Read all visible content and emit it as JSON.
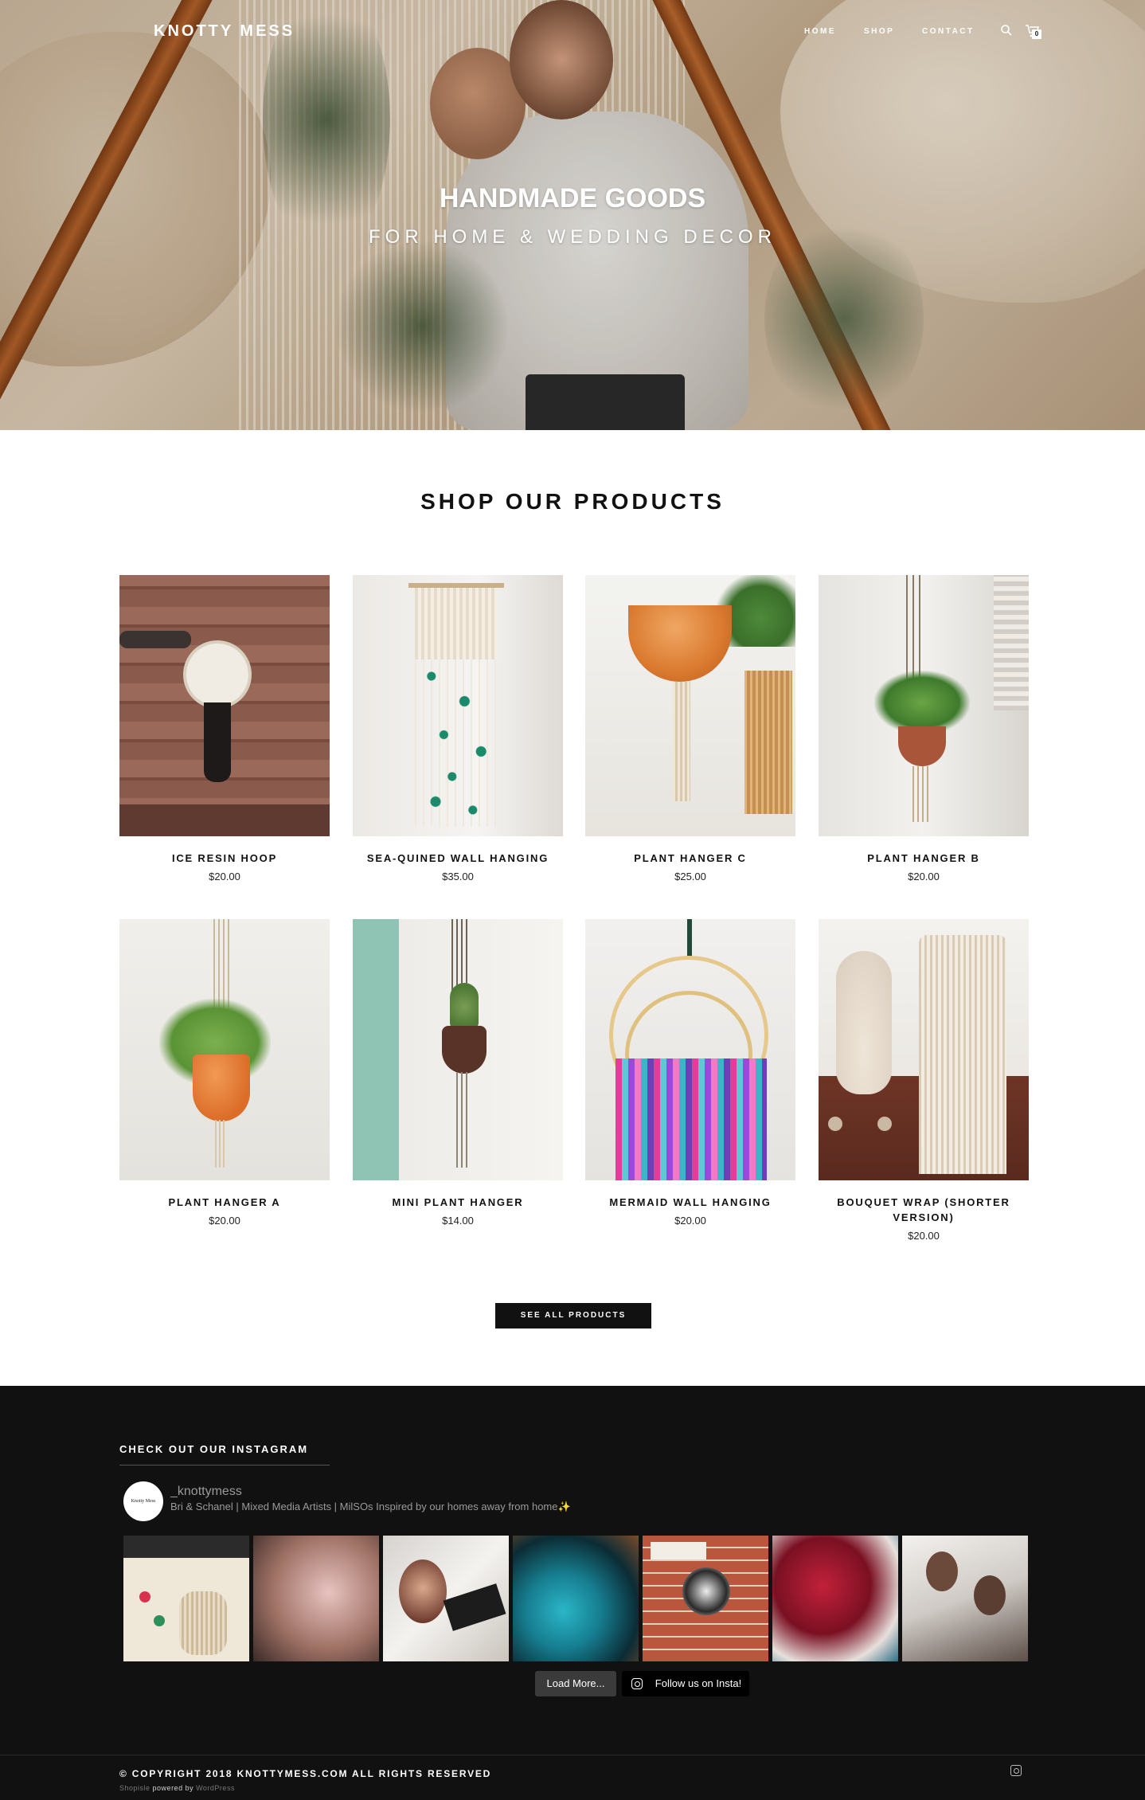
{
  "header": {
    "logo": "KNOTTY MESS",
    "nav": {
      "home": "HOME",
      "shop": "SHOP",
      "contact": "CONTACT"
    },
    "cart_count": "0",
    "icons": [
      "search-icon",
      "cart-icon"
    ]
  },
  "hero": {
    "title": "HANDMADE GOODS",
    "subtitle": "FOR HOME & WEDDING DECOR"
  },
  "products_section": {
    "title": "SHOP OUR PRODUCTS",
    "items": [
      {
        "name": "ICE RESIN HOOP",
        "price": "$20.00"
      },
      {
        "name": "SEA-QUINED WALL HANGING",
        "price": "$35.00"
      },
      {
        "name": "PLANT HANGER C",
        "price": "$25.00"
      },
      {
        "name": "PLANT HANGER B",
        "price": "$20.00"
      },
      {
        "name": "PLANT HANGER A",
        "price": "$20.00"
      },
      {
        "name": "MINI PLANT HANGER",
        "price": "$14.00"
      },
      {
        "name": "MERMAID WALL HANGING",
        "price": "$20.00"
      },
      {
        "name": "BOUQUET WRAP (SHORTER VERSION)",
        "price": "$20.00"
      }
    ],
    "see_all": "SEE ALL PRODUCTS"
  },
  "instagram": {
    "title": "CHECK OUT OUR INSTAGRAM",
    "avatar_text": "Knotty Mess",
    "username": "_knottymess",
    "bio": "Bri & Schanel | Mixed Media Artists | MilSOs Inspired by our homes away from home✨",
    "load_more": "Load More...",
    "follow": "Follow us on Insta!"
  },
  "footer": {
    "copyright": "© COPYRIGHT 2018 KNOTTYMESS.COM ALL RIGHTS RESERVED",
    "theme": "Shopisle",
    "powered_by": "powered by",
    "platform": "WordPress"
  },
  "colors": {
    "accent": "#111111",
    "footer_bg": "#111111",
    "text_muted": "#9a9a9a"
  }
}
